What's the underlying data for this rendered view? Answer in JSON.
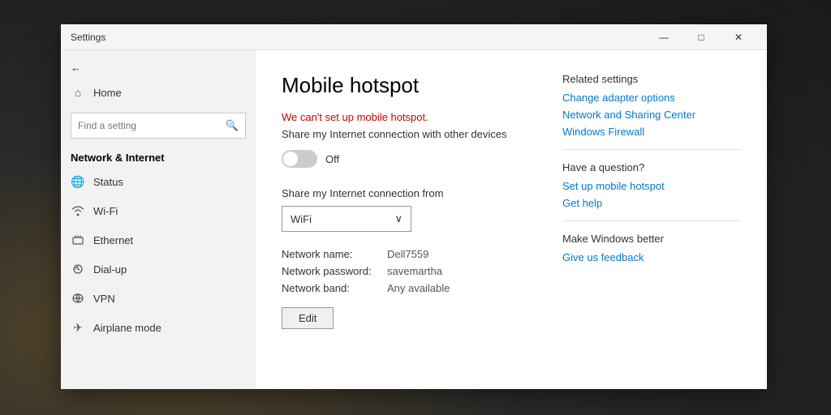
{
  "window": {
    "title": "Settings",
    "controls": {
      "minimize": "—",
      "maximize": "□",
      "close": "✕"
    }
  },
  "sidebar": {
    "back_label": "←",
    "home_label": "Home",
    "home_icon": "⌂",
    "search_placeholder": "Find a setting",
    "search_icon": "🔍",
    "section_title": "Network & Internet",
    "nav_items": [
      {
        "id": "status",
        "label": "Status",
        "icon": "🌐"
      },
      {
        "id": "wifi",
        "label": "Wi-Fi",
        "icon": "📶"
      },
      {
        "id": "ethernet",
        "label": "Ethernet",
        "icon": "🖥"
      },
      {
        "id": "dialup",
        "label": "Dial-up",
        "icon": "📞"
      },
      {
        "id": "vpn",
        "label": "VPN",
        "icon": "🔒"
      },
      {
        "id": "airplane",
        "label": "Airplane mode",
        "icon": "✈"
      }
    ]
  },
  "main": {
    "page_title": "Mobile hotspot",
    "error_text": "We can't set up mobile hotspot.",
    "share_desc": "Share my Internet connection with other devices",
    "toggle_state": "off",
    "toggle_label": "Off",
    "share_from_label": "Share my Internet connection from",
    "dropdown_value": "WiFi",
    "dropdown_icon": "∨",
    "network_name_label": "Network name:",
    "network_name_value": "Dell7559",
    "network_password_label": "Network password:",
    "network_password_value": "savemartha",
    "network_band_label": "Network band:",
    "network_band_value": "Any available",
    "edit_button_label": "Edit"
  },
  "related_settings": {
    "title": "Related settings",
    "links": [
      "Change adapter options",
      "Network and Sharing Center",
      "Windows Firewall"
    ]
  },
  "have_a_question": {
    "title": "Have a question?",
    "links": [
      "Set up mobile hotspot",
      "Get help"
    ]
  },
  "make_better": {
    "title": "Make Windows better",
    "links": [
      "Give us feedback"
    ]
  }
}
